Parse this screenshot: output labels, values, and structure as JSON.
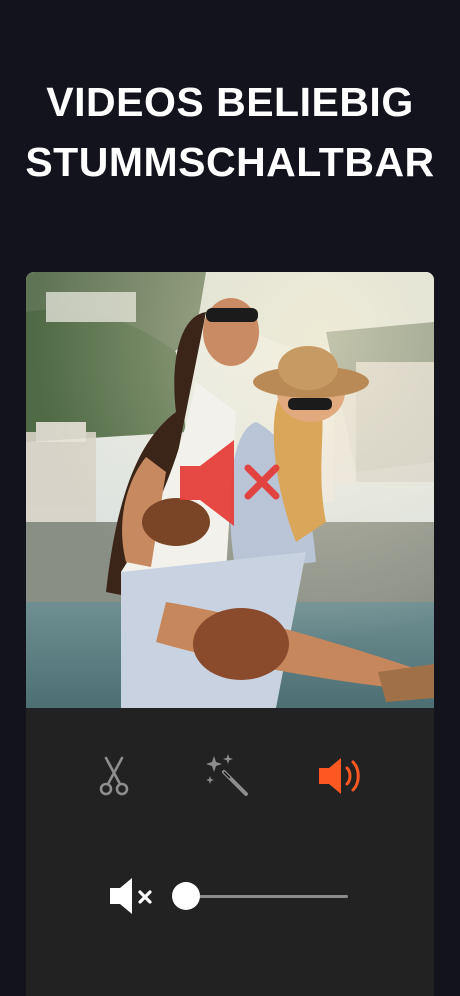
{
  "headline": {
    "line1": "VIDEOS BELIEBIG",
    "line2": "STUMMSCHALTBAR"
  },
  "video": {
    "overlay_icon": "speaker-muted-icon",
    "overlay_color": "#e53935"
  },
  "toolbar": {
    "tools": [
      {
        "icon": "scissors-icon",
        "active": false
      },
      {
        "icon": "magic-wand-icon",
        "active": false
      },
      {
        "icon": "speaker-volume-icon",
        "active": true
      }
    ],
    "active_color": "#ff5722",
    "inactive_color": "#8e8e8e"
  },
  "volume": {
    "icon": "speaker-mute-icon",
    "level": 0
  }
}
